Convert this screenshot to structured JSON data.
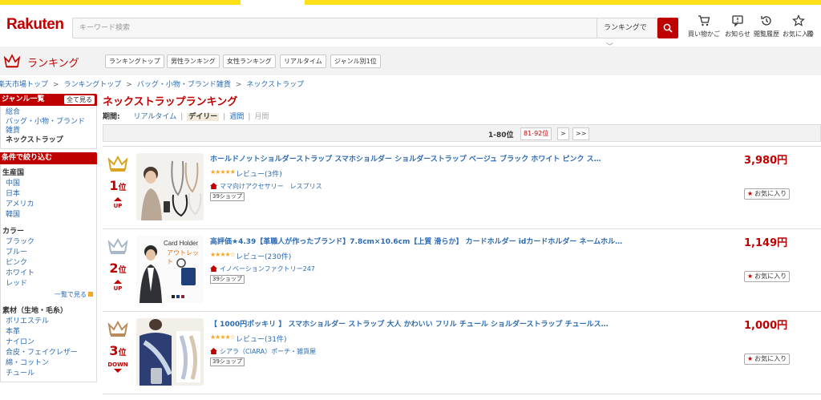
{
  "header": {
    "logo": "Rakuten",
    "search_placeholder": "キーワード検索",
    "search_scope": "ランキングで",
    "icons": [
      {
        "name": "cart-icon",
        "label": "買い物かご"
      },
      {
        "name": "notice-icon",
        "label": "お知らせ"
      },
      {
        "name": "history-icon",
        "label": "閲覧履歴"
      },
      {
        "name": "star-icon",
        "label": "お気に入り"
      }
    ],
    "icon_cut_label": "履"
  },
  "ranking_bar": {
    "title": "ランキング",
    "tabs": [
      "ランキングトップ",
      "男性ランキング",
      "女性ランキング",
      "リアルタイム",
      "ジャンル別1位"
    ]
  },
  "breadcrumb": [
    "楽天市場トップ",
    "ランキングトップ",
    "バッグ・小物・ブランド雑貨",
    "ネックストラップ"
  ],
  "sidebar": {
    "genre_title": "ジャンル一覧",
    "genre_all": "全て見る",
    "genres": [
      "総合",
      "バッグ・小物・ブランド",
      "雑貨",
      "ネックストラップ"
    ],
    "filter_title": "条件で絞り込む",
    "groups": [
      {
        "label": "生産国",
        "items": [
          "中国",
          "日本",
          "アメリカ",
          "韓国"
        ]
      },
      {
        "label": "カラー",
        "items": [
          "ブラック",
          "ブルー",
          "ピンク",
          "ホワイト",
          "レッド"
        ],
        "more": "一覧で見る"
      },
      {
        "label": "素材（生地・毛糸）",
        "items": [
          "ポリエステル",
          "本革",
          "ナイロン",
          "合皮・フェイクレザー",
          "綿・コットン",
          "チュール"
        ]
      }
    ]
  },
  "main": {
    "title": "ネックストラップランキング",
    "period_label": "期間:",
    "periods": [
      "リアルタイム",
      "デイリー",
      "週間",
      "月間"
    ],
    "pager": {
      "current": "1-80位",
      "next_range": "81-92位",
      "next": ">",
      "last": ">>"
    }
  },
  "items": [
    {
      "rank": "1",
      "rank_suffix": "位",
      "trend": "UP",
      "name": "ホールドノットショルダーストラップ スマホショルダー ショルダーストラップ ベージュ ブラック ホワイト ピンク ス…",
      "stars": "★★★★★",
      "review": "レビュー(3件)",
      "shop": "ママ向けアクセサリー　レスプリス",
      "badge": "39ショップ",
      "price": "3,980円",
      "fav": "お気に入り",
      "thumb_texts": []
    },
    {
      "rank": "2",
      "rank_suffix": "位",
      "trend": "UP",
      "name": "高評価★4.39【革職人が作ったブランド】7.8cm×10.6cm【上質 滑らか】 カードホルダー idカードホルダー ネームホル…",
      "stars": "★★★★☆",
      "review": "レビュー(230件)",
      "shop": "イノベーションファクトリー247",
      "badge": "39ショップ",
      "price": "1,149円",
      "fav": "お気に入り",
      "thumb_texts": [
        "Card Holder",
        "アウトレット"
      ]
    },
    {
      "rank": "3",
      "rank_suffix": "位",
      "trend": "DOWN",
      "name": "【 1000円ポッキリ 】 スマホショルダー ストラップ 大人 かわいい フリル チュール ショルダーストラップ チュールス…",
      "stars": "★★★★☆",
      "review": "レビュー(31件)",
      "shop": "シアラ（CIARA）ポーチ・雑貨屋",
      "badge": "39ショップ",
      "price": "1,000円",
      "fav": "お気に入り",
      "thumb_texts": []
    }
  ],
  "colors": {
    "brand_red": "#bf0000",
    "link_blue": "#2b6bb3",
    "banner_yellow": "#ffdf1a",
    "gold": "#d9a520",
    "silver": "#a9b8c9",
    "bronze": "#b98a5a"
  }
}
